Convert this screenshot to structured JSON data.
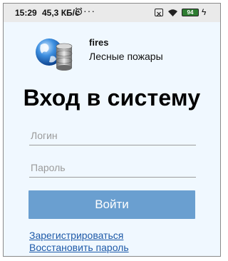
{
  "status_bar": {
    "time": "15:29",
    "network_speed": "45,3 КБ/с",
    "battery_level": "94",
    "icons": [
      "alarm-icon",
      "more-dots-icon",
      "sim-x-icon",
      "wifi-icon",
      "battery-icon",
      "charging-icon"
    ]
  },
  "app": {
    "name": "fires",
    "subtitle": "Лесные пожары",
    "logo_icon": "globe-database-icon"
  },
  "login": {
    "title": "Вход в систему",
    "login_placeholder": "Логин",
    "password_placeholder": "Пароль",
    "submit_label": "Войти",
    "register_link": "Зарегистрироваться",
    "restore_link": "Восстановить пароль"
  },
  "colors": {
    "background": "#f0f8ff",
    "button": "#6a9fd0",
    "link": "#1e5aa8"
  }
}
